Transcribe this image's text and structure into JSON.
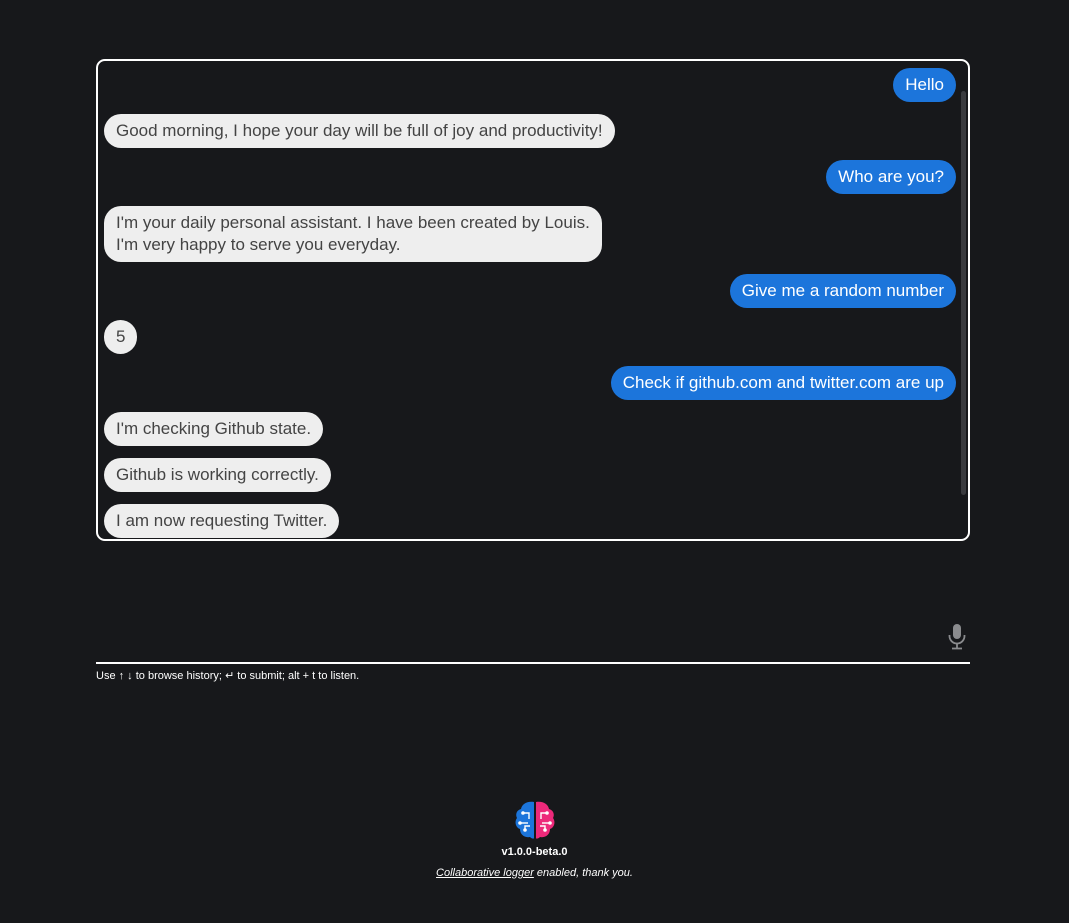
{
  "feed": {
    "messages": [
      {
        "who": "me",
        "text": "Hello"
      },
      {
        "who": "leon",
        "text": "Good morning, I hope your day will be full of joy and productivity!"
      },
      {
        "who": "me",
        "text": "Who are you?"
      },
      {
        "who": "leon",
        "text": "I'm your daily personal assistant. I have been created by Louis.\nI'm very happy to serve you everyday."
      },
      {
        "who": "me",
        "text": "Give me a random number"
      },
      {
        "who": "leon",
        "text": "5"
      },
      {
        "who": "me",
        "text": "Check if github.com and twitter.com are up"
      },
      {
        "who": "leon",
        "text": "I'm checking Github state."
      },
      {
        "who": "leon",
        "text": "Github is working correctly."
      },
      {
        "who": "leon",
        "text": "I am now requesting Twitter."
      }
    ]
  },
  "input": {
    "value": "",
    "placeholder": ""
  },
  "icons": {
    "mic": "microphone-icon",
    "logo": "brain-logo"
  },
  "hint": "Use ↑ ↓ to browse history; ↵ to submit; alt + t to listen.",
  "footer": {
    "version": "v1.0.0-beta.0",
    "logger_link": "Collaborative logger",
    "logger_suffix": " enabled, thank you."
  },
  "colors": {
    "background": "#17181b",
    "user_bubble": "#1c75db",
    "assistant_bubble": "#eeeeee",
    "logo_blue": "#1c75db",
    "logo_pink": "#ed297a"
  }
}
